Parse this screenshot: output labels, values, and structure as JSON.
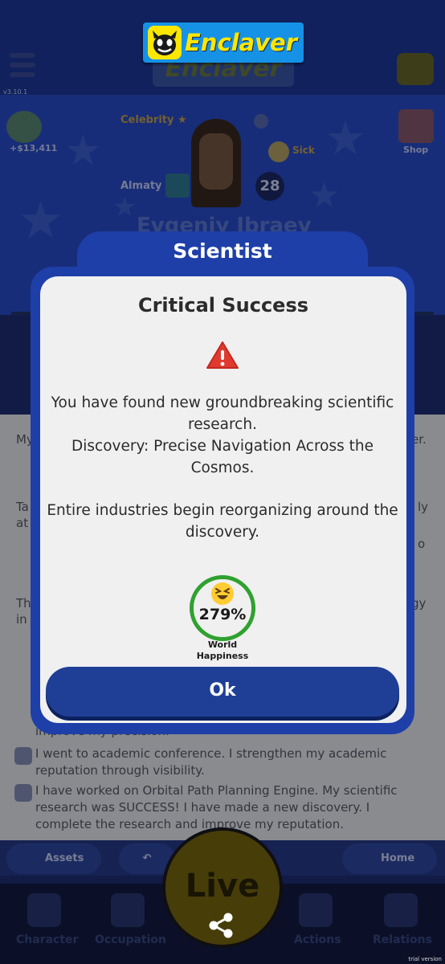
{
  "app": {
    "logo_text": "Enclaver",
    "version": "v3.10.1",
    "trial_label": "trial version"
  },
  "profile": {
    "money": "+$13,411",
    "shop_label": "Shop",
    "status_celebrity": "Celebrity",
    "status_sick": "Sick",
    "city": "Almaty",
    "age": "28",
    "name": "Evgeniy Ibraev"
  },
  "log": {
    "fragments": [
      "My",
      "er.",
      "Ta",
      "ly",
      "at",
      "o",
      "Th",
      "gy",
      "in"
    ],
    "partial_line": "improve my precision.",
    "entries": [
      "I went to academic conference. I strengthen my academic reputation through visibility.",
      "I have worked on Orbital Path Planning Engine. My scientific research was SUCCESS! I have made a new discovery. I complete the research and improve my reputation."
    ]
  },
  "bottom": {
    "assets_label": "Assets",
    "home_label": "Home",
    "live_label": "Live",
    "tabs": [
      "Character",
      "Occupation",
      "Actions",
      "Relations"
    ]
  },
  "dialog": {
    "header": "Scientist",
    "title": "Critical Success",
    "body_lines": [
      "You have found new groundbreaking scientific research.",
      "Discovery: Precise Navigation Across the Cosmos."
    ],
    "body_note": "Entire industries begin reorganizing around the discovery.",
    "happiness_value": "279%",
    "happiness_label": "World Happiness",
    "ok_label": "Ok"
  },
  "colors": {
    "dialog_blue": "#1e3fa8",
    "ok_button": "#1f3f96",
    "happiness_ring": "#2fa12f",
    "logo_yellow": "#ffe600",
    "logo_blue": "#1592e6"
  }
}
